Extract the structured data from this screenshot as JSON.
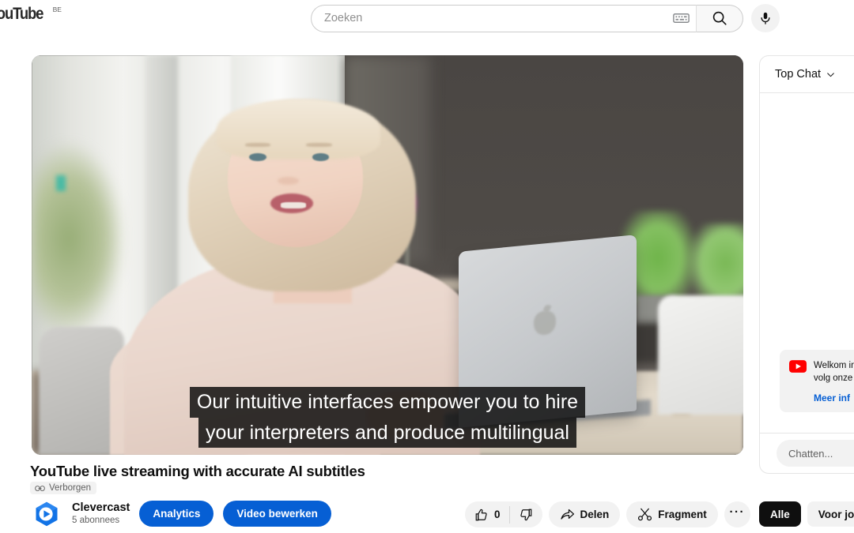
{
  "masthead": {
    "logo_text": "YouTube",
    "logo_country": "BE",
    "search": {
      "placeholder": "Zoeken",
      "value": "",
      "keyboard_icon": "keyboard-icon",
      "search_icon": "search-icon"
    },
    "mic_icon": "microphone-icon"
  },
  "player": {
    "subtitles": [
      "Our intuitive interfaces empower you to hire",
      "your interpreters and produce multilingual"
    ],
    "scene_description": "blonde woman in pale pink blouse at a table with a silver MacBook in a bright modern office"
  },
  "video": {
    "title": "YouTube live streaming with accurate AI subtitles",
    "visibility_badge": {
      "label": "Verborgen",
      "icon": "link-icon"
    },
    "channel": {
      "name": "Clevercast",
      "subscribers": "5 abonnees",
      "avatar_icon": "clevercast-logo"
    },
    "buttons": {
      "analytics": "Analytics",
      "edit_video": "Video bewerken"
    },
    "actions": {
      "like_count": "0",
      "like_icon": "thumbs-up-icon",
      "dislike_icon": "thumbs-down-icon",
      "share_label": "Delen",
      "share_icon": "share-arrow-icon",
      "clip_label": "Fragment",
      "clip_icon": "scissors-icon",
      "more_label": "···"
    }
  },
  "chat": {
    "header_label": "Top Chat",
    "header_icon": "chevron-down-icon",
    "notice": {
      "icon": "youtube-play-icon",
      "line1": "Welkom in",
      "line2": "volg onze",
      "link": "Meer inf"
    },
    "input_placeholder": "Chatten...",
    "chips": [
      {
        "label": "Alle",
        "active": true
      },
      {
        "label": "Voor jou",
        "active": false
      }
    ]
  },
  "colors": {
    "brand_blue": "#065fd4",
    "youtube_red": "#ff0000",
    "chip_active_bg": "#0f0f0f",
    "pill_grey": "#f2f2f2"
  }
}
